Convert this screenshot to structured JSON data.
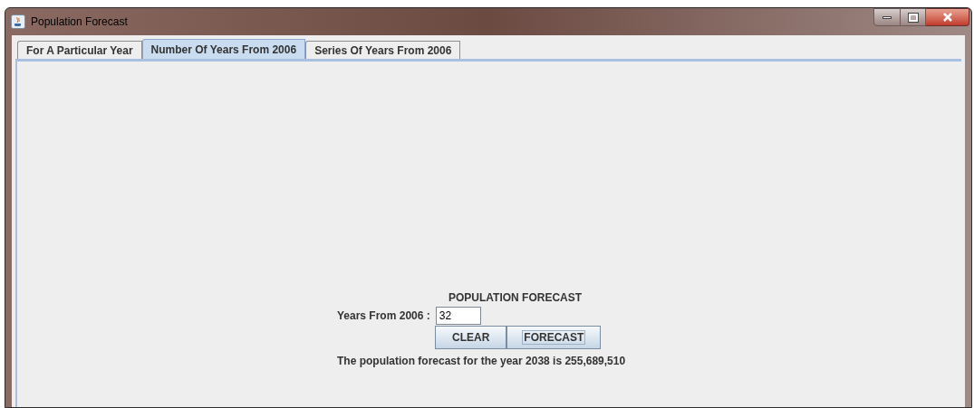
{
  "window": {
    "title": "Population Forecast"
  },
  "tabs": [
    {
      "label": "For A Particular Year",
      "selected": false
    },
    {
      "label": "Number Of Years From 2006",
      "selected": true
    },
    {
      "label": "Series Of Years From 2006",
      "selected": false
    }
  ],
  "form": {
    "heading": "POPULATION FORECAST",
    "field_label": "Years From 2006 :",
    "field_value": "32",
    "buttons": [
      {
        "label": "CLEAR",
        "focused": false
      },
      {
        "label": "FORECAST",
        "focused": true
      }
    ],
    "result": "The population forecast for the year 2038 is 255,689,510"
  }
}
